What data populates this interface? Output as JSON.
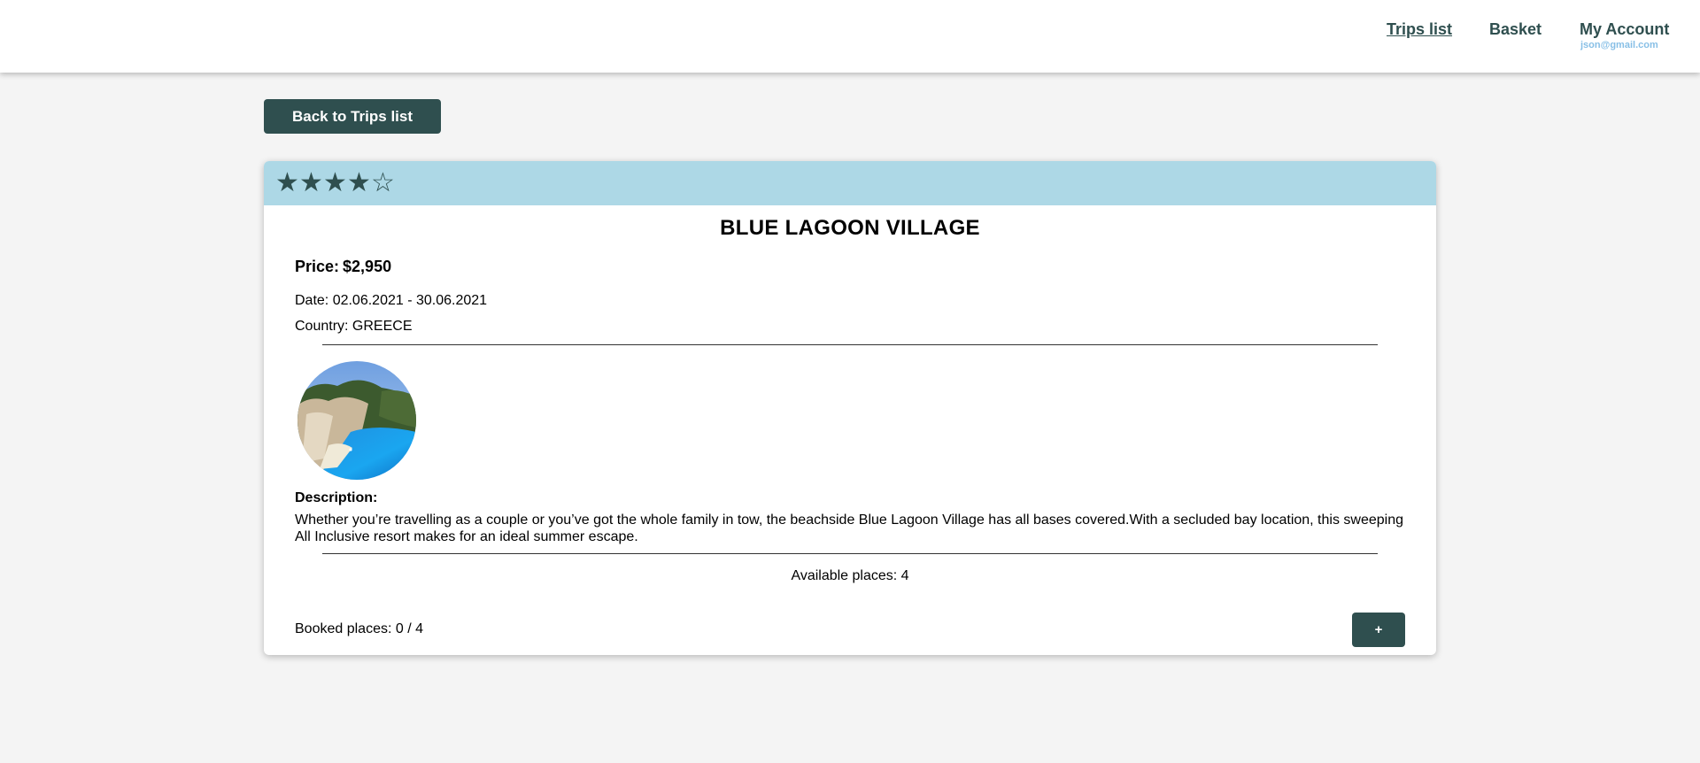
{
  "nav": {
    "trips_list": "Trips list",
    "basket": "Basket",
    "my_account": "My Account",
    "account_email": "json@gmail.com"
  },
  "back_button": "Back to Trips list",
  "trip": {
    "rating": 4,
    "rating_max": 5,
    "stars": [
      "★",
      "★",
      "★",
      "★",
      "☆"
    ],
    "name": "BLUE LAGOON VILLAGE",
    "price_label": "Price:",
    "price_value": "$2,950",
    "date": "Date: 02.06.2021 - 30.06.2021",
    "country": "Country: GREECE",
    "description_label": "Description:",
    "description": "Whether you’re travelling as a couple or you’ve got the whole family in tow, the beachside Blue Lagoon Village has all bases covered.With a secluded bay location, this sweeping All Inclusive resort makes for an ideal summer escape.",
    "available": "Available places: 4",
    "booked": "Booked places: 0 / 4",
    "add_button": "+"
  },
  "colors": {
    "primary": "#2f4f4f",
    "header": "#add8e6",
    "email": "#87bfe6",
    "background": "#f4f4f4"
  }
}
